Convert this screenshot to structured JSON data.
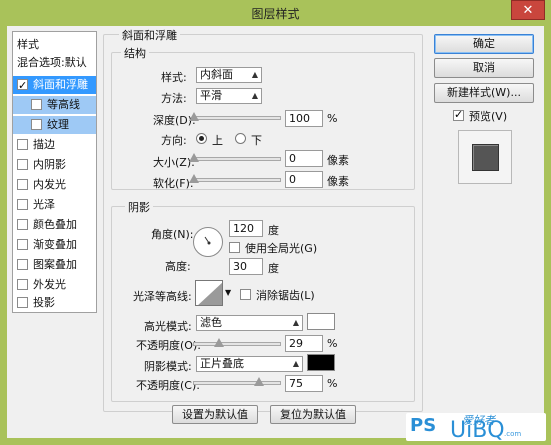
{
  "window": {
    "title": "图层样式",
    "close_label": "✕"
  },
  "left_list": {
    "header": "样式",
    "blend_options": "混合选项:默认",
    "items": [
      {
        "label": "斜面和浮雕",
        "checked": true,
        "selected": true
      },
      {
        "label": "等高线",
        "checked": false,
        "sub": true
      },
      {
        "label": "纹理",
        "checked": false,
        "sub": true
      },
      {
        "label": "描边",
        "checked": false
      },
      {
        "label": "内阴影",
        "checked": false
      },
      {
        "label": "内发光",
        "checked": false
      },
      {
        "label": "光泽",
        "checked": false
      },
      {
        "label": "颜色叠加",
        "checked": false
      },
      {
        "label": "渐变叠加",
        "checked": false
      },
      {
        "label": "图案叠加",
        "checked": false
      },
      {
        "label": "外发光",
        "checked": false
      },
      {
        "label": "投影",
        "checked": false
      }
    ]
  },
  "bevel": {
    "group_title": "斜面和浮雕",
    "structure_title": "结构",
    "style_label": "样式:",
    "style_value": "内斜面",
    "technique_label": "方法:",
    "technique_value": "平滑",
    "depth_label": "深度(D):",
    "depth_value": "100",
    "depth_unit": "%",
    "direction_label": "方向:",
    "dir_up": "上",
    "dir_down": "下",
    "dir_selected": "上",
    "size_label": "大小(Z):",
    "size_value": "0",
    "size_unit": "像素",
    "soften_label": "软化(F):",
    "soften_value": "0",
    "soften_unit": "像素"
  },
  "shading": {
    "title": "阴影",
    "angle_label": "角度(N):",
    "angle_value": "120",
    "angle_unit": "度",
    "global_light_label": "使用全局光(G)",
    "altitude_label": "高度:",
    "altitude_value": "30",
    "altitude_unit": "度",
    "gloss_label": "光泽等高线:",
    "antialias_label": "消除锯齿(L)",
    "highlight_mode_label": "高光模式:",
    "highlight_mode_value": "滤色",
    "highlight_color": "#ffffff",
    "highlight_opacity_label": "不透明度(O):",
    "highlight_opacity_value": "29",
    "highlight_opacity_unit": "%",
    "shadow_mode_label": "阴影模式:",
    "shadow_mode_value": "正片叠底",
    "shadow_color": "#000000",
    "shadow_opacity_label": "不透明度(C):",
    "shadow_opacity_value": "75",
    "shadow_opacity_unit": "%"
  },
  "bottom_buttons": {
    "set_default": "设置为默认值",
    "reset_default": "复位为默认值"
  },
  "right_panel": {
    "ok": "确定",
    "cancel": "取消",
    "new_style": "新建样式(W)...",
    "preview_label": "预览(V)",
    "preview_checked": true
  },
  "watermark": {
    "ps": "PS",
    "zh": "爱好者",
    "uibo": "UiBQ",
    "com": ".com"
  },
  "sliders": {
    "depth": 0.0,
    "size": 0.0,
    "soften": 0.0,
    "highlight_opacity": 0.29,
    "shadow_opacity": 0.75
  }
}
